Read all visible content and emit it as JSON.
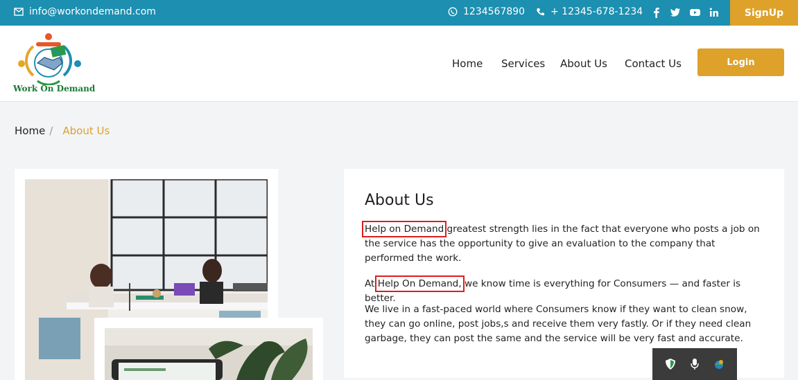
{
  "topbar": {
    "email": "info@workondemand.com",
    "phone1": "1234567890",
    "phone2": "+ 12345-678-1234",
    "social": [
      "facebook-icon",
      "twitter-icon",
      "youtube-icon",
      "linkedin-icon"
    ],
    "signup_label": "SignUp"
  },
  "header": {
    "logo_text": "Work On Demand",
    "nav": [
      "Home",
      "Services",
      "About Us",
      "Contact Us"
    ],
    "login_label": "Login"
  },
  "breadcrumb": {
    "home": "Home",
    "separator": "/",
    "current": "About Us"
  },
  "about": {
    "title": "About Us",
    "p1_highlight": "Help on Demand",
    "p1_rest": " greatest strength lies in the fact that everyone who posts a job on the service has the opportunity to give an evaluation to the company that performed the work.",
    "p2_prefix": "At ",
    "p2_highlight": "Help On Demand,",
    "p2_rest": " we know time is everything for Consumers — and faster is better.",
    "p3": "We live in a fast-paced world where Consumers know if they want to clean snow, they can go online, post jobs,s and receive them very fastly. Or if they need clean garbage, they can post the same and the service will be very fast and accurate."
  },
  "colors": {
    "topbar": "#1d8fb0",
    "accent": "#dea12a",
    "highlight_box": "#e01b1b"
  },
  "tray": [
    "security-shield-icon",
    "microphone-icon",
    "network-icon"
  ]
}
